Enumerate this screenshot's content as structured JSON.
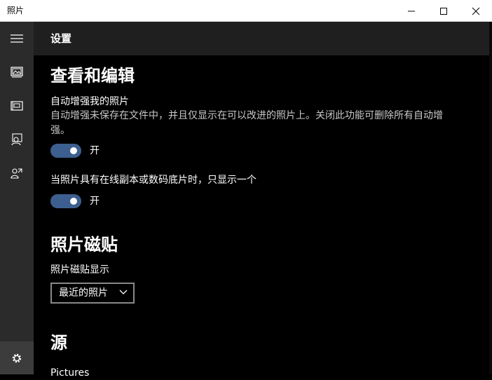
{
  "titlebar": {
    "title": "照片"
  },
  "header": {
    "title": "设置"
  },
  "sections": {
    "view_edit": {
      "heading": "查看和编辑",
      "auto_enhance": {
        "label": "自动增强我的照片",
        "description": "自动增强未保存在文件中，并且仅显示在可以改进的照片上。关闭此功能可删除所有自动增强。",
        "toggle_text": "开"
      },
      "linked_duplicates": {
        "label": "当照片具有在线副本或数码底片时，只显示一个",
        "toggle_text": "开"
      }
    },
    "tile": {
      "heading": "照片磁贴",
      "label": "照片磁贴显示",
      "selected": "最近的照片"
    },
    "source": {
      "heading": "源",
      "first_item": "Pictures"
    }
  },
  "colors": {
    "accent": "#3d5f8f",
    "nav_bg": "#2b2b2b",
    "header_bg": "#1f1f1f"
  }
}
